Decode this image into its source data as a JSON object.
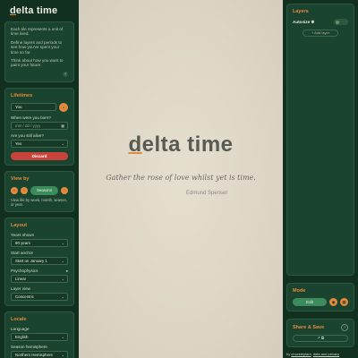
{
  "brand": {
    "prefix": "d",
    "rest": "elta time"
  },
  "intro": {
    "lines": [
      "Each tile represents a unit of time lived.",
      "Define layers and periods to see how you've spent your time so far.",
      "Think about how you want to paint your future."
    ]
  },
  "lifetimes": {
    "title": "Lifetimes",
    "profile_value": "You",
    "born_label": "When were you born?",
    "born_placeholder": "mm / dd / yyyy",
    "alive_label": "Are you still alive?",
    "alive_value": "Yes",
    "discard_label": "Discard"
  },
  "view_by": {
    "title": "View by",
    "value": "Seasons",
    "note": "View life by week, month, season, or year."
  },
  "layout": {
    "title": "Layout",
    "years_label": "Years shown",
    "years_value": "90 years",
    "start_label": "Start anchor",
    "start_value": "Start on January 1",
    "psych_label": "Psychophysics",
    "psych_value": "Linear",
    "layer_view_label": "Layer view",
    "layer_view_value": "Concentric"
  },
  "locale": {
    "title": "Locale",
    "language_label": "Language",
    "language_value": "English",
    "season_label": "Season hemisphere",
    "season_value": "Northern Hemisphere"
  },
  "canvas": {
    "title_prefix": "d",
    "title_rest": "elta time",
    "quote": "Gather the rose of love whilst yet is time.",
    "author": "Edmund Spenser"
  },
  "layers": {
    "title": "Layers",
    "autosize_label": "Autosize",
    "add_label": "+ Add layer"
  },
  "mode": {
    "title": "Mode",
    "edit_label": "Edit"
  },
  "share": {
    "title": "Share & Save",
    "button_label": "↗ ⧉"
  },
  "footer": {
    "prefix": "by ",
    "author": "chuckleplant",
    "mid": ", ",
    "link": "data and privacy"
  },
  "colors": {
    "accent": "#e38a3c",
    "green_button": "#3c8b5d",
    "danger": "#c8443b",
    "panel": "#1b4430",
    "canvas": "#e5dfd0"
  }
}
